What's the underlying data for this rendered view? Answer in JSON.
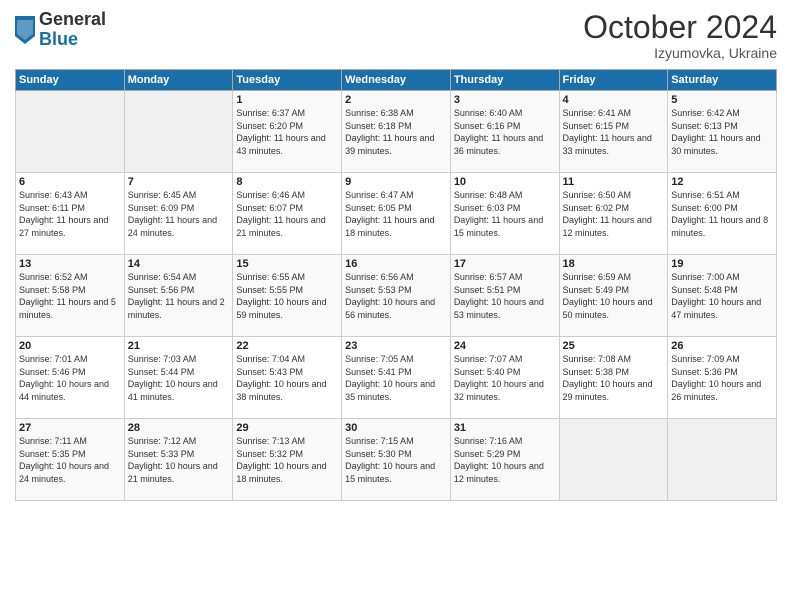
{
  "logo": {
    "general": "General",
    "blue": "Blue"
  },
  "header": {
    "month": "October 2024",
    "location": "Izyumovka, Ukraine"
  },
  "weekdays": [
    "Sunday",
    "Monday",
    "Tuesday",
    "Wednesday",
    "Thursday",
    "Friday",
    "Saturday"
  ],
  "weeks": [
    [
      {
        "day": "",
        "sunrise": "",
        "sunset": "",
        "daylight": ""
      },
      {
        "day": "",
        "sunrise": "",
        "sunset": "",
        "daylight": ""
      },
      {
        "day": "1",
        "sunrise": "Sunrise: 6:37 AM",
        "sunset": "Sunset: 6:20 PM",
        "daylight": "Daylight: 11 hours and 43 minutes."
      },
      {
        "day": "2",
        "sunrise": "Sunrise: 6:38 AM",
        "sunset": "Sunset: 6:18 PM",
        "daylight": "Daylight: 11 hours and 39 minutes."
      },
      {
        "day": "3",
        "sunrise": "Sunrise: 6:40 AM",
        "sunset": "Sunset: 6:16 PM",
        "daylight": "Daylight: 11 hours and 36 minutes."
      },
      {
        "day": "4",
        "sunrise": "Sunrise: 6:41 AM",
        "sunset": "Sunset: 6:15 PM",
        "daylight": "Daylight: 11 hours and 33 minutes."
      },
      {
        "day": "5",
        "sunrise": "Sunrise: 6:42 AM",
        "sunset": "Sunset: 6:13 PM",
        "daylight": "Daylight: 11 hours and 30 minutes."
      }
    ],
    [
      {
        "day": "6",
        "sunrise": "Sunrise: 6:43 AM",
        "sunset": "Sunset: 6:11 PM",
        "daylight": "Daylight: 11 hours and 27 minutes."
      },
      {
        "day": "7",
        "sunrise": "Sunrise: 6:45 AM",
        "sunset": "Sunset: 6:09 PM",
        "daylight": "Daylight: 11 hours and 24 minutes."
      },
      {
        "day": "8",
        "sunrise": "Sunrise: 6:46 AM",
        "sunset": "Sunset: 6:07 PM",
        "daylight": "Daylight: 11 hours and 21 minutes."
      },
      {
        "day": "9",
        "sunrise": "Sunrise: 6:47 AM",
        "sunset": "Sunset: 6:05 PM",
        "daylight": "Daylight: 11 hours and 18 minutes."
      },
      {
        "day": "10",
        "sunrise": "Sunrise: 6:48 AM",
        "sunset": "Sunset: 6:03 PM",
        "daylight": "Daylight: 11 hours and 15 minutes."
      },
      {
        "day": "11",
        "sunrise": "Sunrise: 6:50 AM",
        "sunset": "Sunset: 6:02 PM",
        "daylight": "Daylight: 11 hours and 12 minutes."
      },
      {
        "day": "12",
        "sunrise": "Sunrise: 6:51 AM",
        "sunset": "Sunset: 6:00 PM",
        "daylight": "Daylight: 11 hours and 8 minutes."
      }
    ],
    [
      {
        "day": "13",
        "sunrise": "Sunrise: 6:52 AM",
        "sunset": "Sunset: 5:58 PM",
        "daylight": "Daylight: 11 hours and 5 minutes."
      },
      {
        "day": "14",
        "sunrise": "Sunrise: 6:54 AM",
        "sunset": "Sunset: 5:56 PM",
        "daylight": "Daylight: 11 hours and 2 minutes."
      },
      {
        "day": "15",
        "sunrise": "Sunrise: 6:55 AM",
        "sunset": "Sunset: 5:55 PM",
        "daylight": "Daylight: 10 hours and 59 minutes."
      },
      {
        "day": "16",
        "sunrise": "Sunrise: 6:56 AM",
        "sunset": "Sunset: 5:53 PM",
        "daylight": "Daylight: 10 hours and 56 minutes."
      },
      {
        "day": "17",
        "sunrise": "Sunrise: 6:57 AM",
        "sunset": "Sunset: 5:51 PM",
        "daylight": "Daylight: 10 hours and 53 minutes."
      },
      {
        "day": "18",
        "sunrise": "Sunrise: 6:59 AM",
        "sunset": "Sunset: 5:49 PM",
        "daylight": "Daylight: 10 hours and 50 minutes."
      },
      {
        "day": "19",
        "sunrise": "Sunrise: 7:00 AM",
        "sunset": "Sunset: 5:48 PM",
        "daylight": "Daylight: 10 hours and 47 minutes."
      }
    ],
    [
      {
        "day": "20",
        "sunrise": "Sunrise: 7:01 AM",
        "sunset": "Sunset: 5:46 PM",
        "daylight": "Daylight: 10 hours and 44 minutes."
      },
      {
        "day": "21",
        "sunrise": "Sunrise: 7:03 AM",
        "sunset": "Sunset: 5:44 PM",
        "daylight": "Daylight: 10 hours and 41 minutes."
      },
      {
        "day": "22",
        "sunrise": "Sunrise: 7:04 AM",
        "sunset": "Sunset: 5:43 PM",
        "daylight": "Daylight: 10 hours and 38 minutes."
      },
      {
        "day": "23",
        "sunrise": "Sunrise: 7:05 AM",
        "sunset": "Sunset: 5:41 PM",
        "daylight": "Daylight: 10 hours and 35 minutes."
      },
      {
        "day": "24",
        "sunrise": "Sunrise: 7:07 AM",
        "sunset": "Sunset: 5:40 PM",
        "daylight": "Daylight: 10 hours and 32 minutes."
      },
      {
        "day": "25",
        "sunrise": "Sunrise: 7:08 AM",
        "sunset": "Sunset: 5:38 PM",
        "daylight": "Daylight: 10 hours and 29 minutes."
      },
      {
        "day": "26",
        "sunrise": "Sunrise: 7:09 AM",
        "sunset": "Sunset: 5:36 PM",
        "daylight": "Daylight: 10 hours and 26 minutes."
      }
    ],
    [
      {
        "day": "27",
        "sunrise": "Sunrise: 7:11 AM",
        "sunset": "Sunset: 5:35 PM",
        "daylight": "Daylight: 10 hours and 24 minutes."
      },
      {
        "day": "28",
        "sunrise": "Sunrise: 7:12 AM",
        "sunset": "Sunset: 5:33 PM",
        "daylight": "Daylight: 10 hours and 21 minutes."
      },
      {
        "day": "29",
        "sunrise": "Sunrise: 7:13 AM",
        "sunset": "Sunset: 5:32 PM",
        "daylight": "Daylight: 10 hours and 18 minutes."
      },
      {
        "day": "30",
        "sunrise": "Sunrise: 7:15 AM",
        "sunset": "Sunset: 5:30 PM",
        "daylight": "Daylight: 10 hours and 15 minutes."
      },
      {
        "day": "31",
        "sunrise": "Sunrise: 7:16 AM",
        "sunset": "Sunset: 5:29 PM",
        "daylight": "Daylight: 10 hours and 12 minutes."
      },
      {
        "day": "",
        "sunrise": "",
        "sunset": "",
        "daylight": ""
      },
      {
        "day": "",
        "sunrise": "",
        "sunset": "",
        "daylight": ""
      }
    ]
  ]
}
